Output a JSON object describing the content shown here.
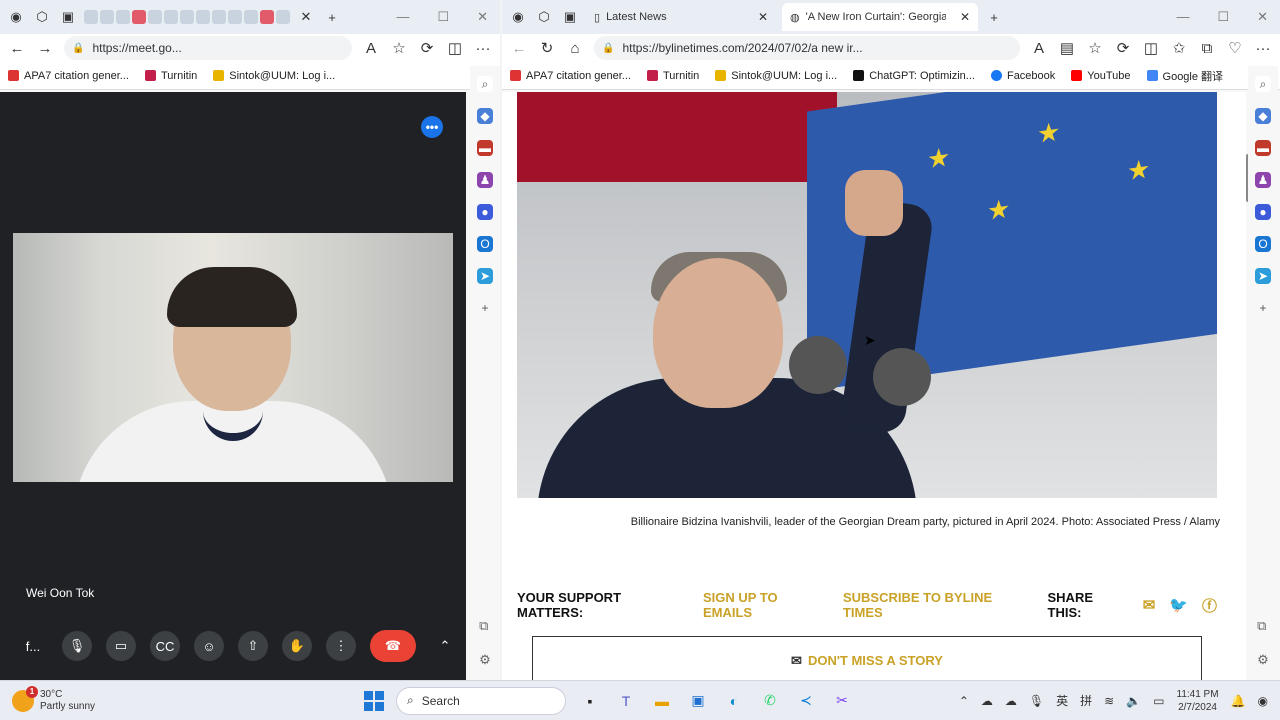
{
  "left_window": {
    "address": "https://meet.go...",
    "bookmarks": [
      "APA7 citation gener...",
      "Turnitin",
      "Sintok@UUM: Log i..."
    ],
    "meet": {
      "participant_name": "Wei Oon Tok",
      "more_label": "•••",
      "controls": [
        "f...",
        "mic",
        "camera",
        "captions",
        "emoji",
        "present",
        "raise-hand",
        "more",
        "end-call",
        "expand"
      ]
    }
  },
  "right_window": {
    "tabs": [
      {
        "label": "Latest News"
      },
      {
        "label": "'A New Iron Curtain': Georgia-Ch"
      }
    ],
    "address": "https://bylinetimes.com/2024/07/02/a new ir...",
    "bookmarks": [
      "APA7 citation gener...",
      "Turnitin",
      "Sintok@UUM: Log i...",
      "ChatGPT: Optimizin...",
      "Facebook",
      "YouTube",
      "Google 翻译"
    ],
    "article": {
      "caption": "Billionaire Bidzina Ivanishvili, leader of the Georgian Dream party, pictured in April 2024. Photo: Associated Press / Alamy",
      "support_label": "YOUR SUPPORT MATTERS:",
      "signup_link": "SIGN UP TO EMAILS",
      "subscribe_link": "SUBSCRIBE TO BYLINE TIMES",
      "share_label": "SHARE THIS:",
      "dont_miss": "DON'T MISS A STORY"
    }
  },
  "taskbar": {
    "weather_temp": "30°C",
    "weather_desc": "Partly sunny",
    "weather_badge": "1",
    "search_placeholder": "Search",
    "ime_lang": "英",
    "ime_mode": "拼",
    "time": "11:41 PM",
    "date": "2/7/2024"
  },
  "colors": {
    "accent_gold": "#c9a227",
    "meet_bg": "#202124",
    "end_call": "#ea4335"
  }
}
